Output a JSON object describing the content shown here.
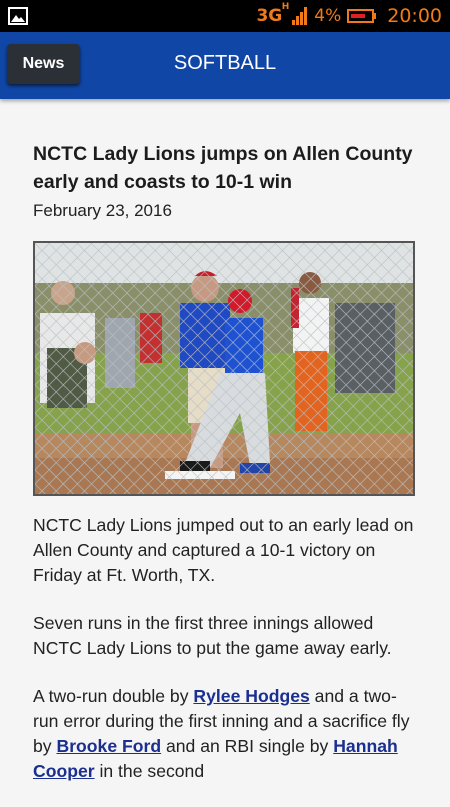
{
  "status_bar": {
    "network": "3G",
    "network_sup": "H",
    "battery_percent": "4%",
    "time": "20:00",
    "accent_color": "#f07a19"
  },
  "app_bar": {
    "back_label": "News",
    "title": "SOFTBALL",
    "color": "#1046a6"
  },
  "article": {
    "headline": "NCTC Lady Lions jumps on Allen County early and coasts to 10-1 win",
    "date": "February 23, 2016",
    "paragraph1": "NCTC Lady Lions jumped out to an early lead on Allen County and captured a 10-1 victory on Friday at Ft. Worth, TX.",
    "paragraph2": "Seven runs in the first three innings allowed NCTC Lady Lions to put the game away early.",
    "paragraph3": {
      "t1": "A two-run double by ",
      "link1": "Rylee Hodges",
      "t2": " and a two-run error during the first inning and a sacrifice fly by ",
      "link2": "Brooke Ford",
      "t3": " and an RBI single by ",
      "link3": "Hannah Cooper",
      "t4": " in the second"
    }
  }
}
